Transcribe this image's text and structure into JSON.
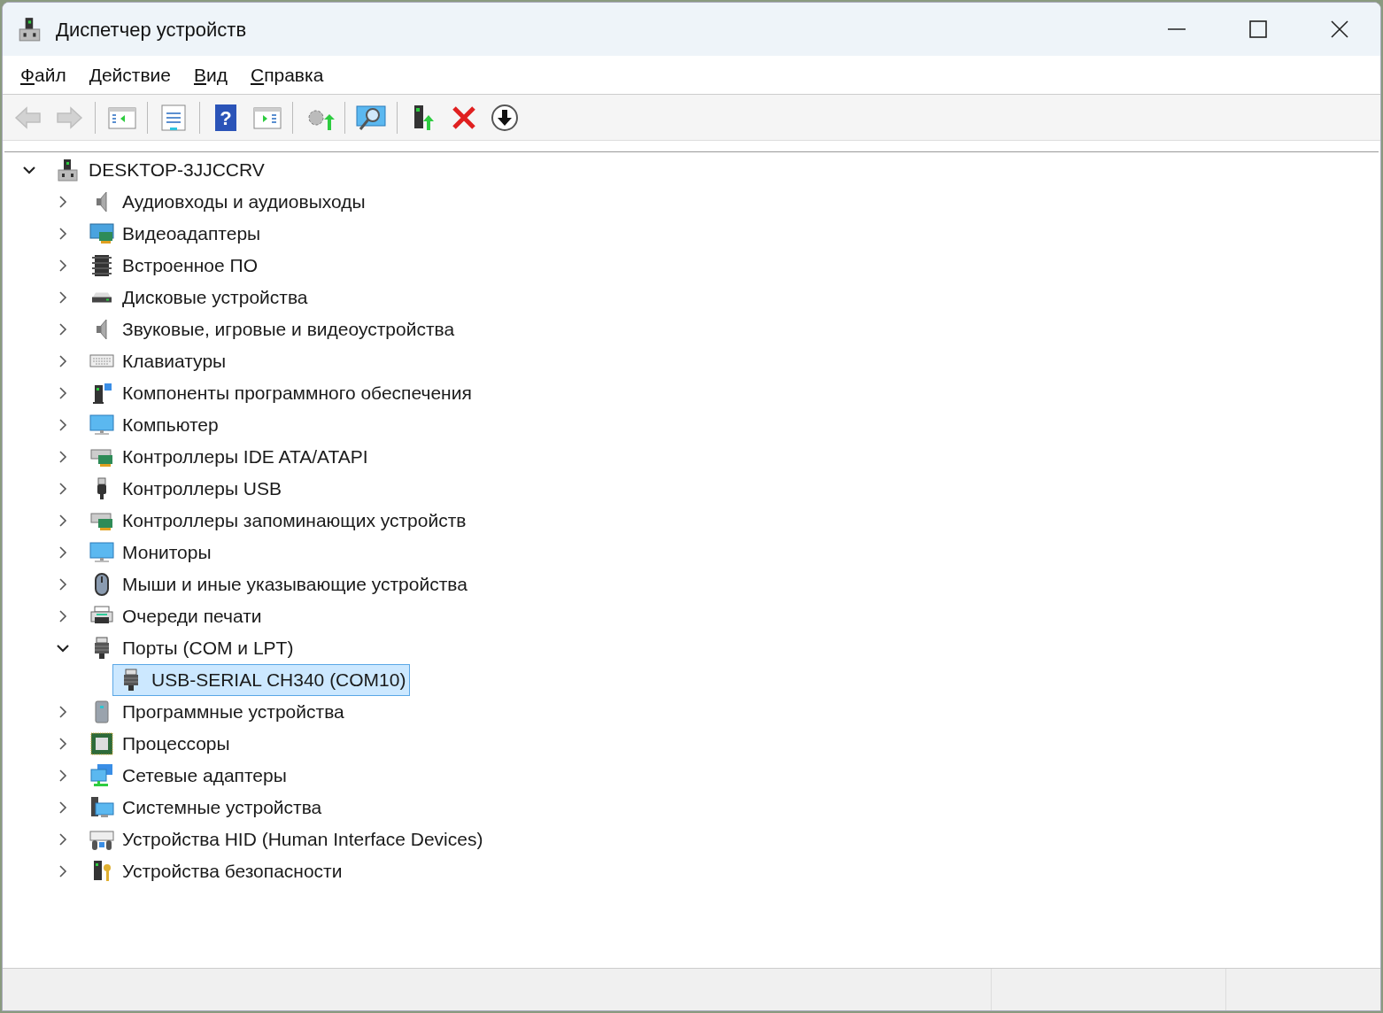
{
  "window": {
    "title": "Диспетчер устройств"
  },
  "menu": [
    {
      "label": "Файл"
    },
    {
      "label": "Действие"
    },
    {
      "label": "Вид"
    },
    {
      "label": "Справка"
    }
  ],
  "toolbar": [
    {
      "kind": "back",
      "disabled": true
    },
    {
      "kind": "forward",
      "disabled": true
    },
    {
      "kind": "separator"
    },
    {
      "kind": "tree-pane",
      "disabled": false
    },
    {
      "kind": "separator"
    },
    {
      "kind": "properties",
      "disabled": false
    },
    {
      "kind": "separator"
    },
    {
      "kind": "help",
      "disabled": false,
      "glyph": "?"
    },
    {
      "kind": "action-pane",
      "disabled": false
    },
    {
      "kind": "separator"
    },
    {
      "kind": "update",
      "disabled": false
    },
    {
      "kind": "separator"
    },
    {
      "kind": "scan",
      "disabled": false
    },
    {
      "kind": "separator"
    },
    {
      "kind": "enable",
      "disabled": false
    },
    {
      "kind": "remove",
      "disabled": false
    },
    {
      "kind": "disable",
      "disabled": false
    }
  ],
  "tree": {
    "label": "DESKTOP-3JJCCRV",
    "kind": "computer-root",
    "expanded": true,
    "selected": false,
    "children": [
      {
        "label": "Аудиовходы и аудиовыходы",
        "kind": "speaker",
        "expanded": false,
        "selected": false
      },
      {
        "label": "Видеоадаптеры",
        "kind": "display-adapter",
        "expanded": false,
        "selected": false
      },
      {
        "label": "Встроенное ПО",
        "kind": "chip",
        "expanded": false,
        "selected": false
      },
      {
        "label": "Дисковые устройства",
        "kind": "disk",
        "expanded": false,
        "selected": false
      },
      {
        "label": "Звуковые, игровые и видеоустройства",
        "kind": "speaker",
        "expanded": false,
        "selected": false
      },
      {
        "label": "Клавиатуры",
        "kind": "keyboard",
        "expanded": false,
        "selected": false
      },
      {
        "label": "Компоненты программного обеспечения",
        "kind": "software-component",
        "expanded": false,
        "selected": false
      },
      {
        "label": "Компьютер",
        "kind": "monitor",
        "expanded": false,
        "selected": false
      },
      {
        "label": "Контроллеры IDE ATA/ATAPI",
        "kind": "controller",
        "expanded": false,
        "selected": false
      },
      {
        "label": "Контроллеры USB",
        "kind": "usb",
        "expanded": false,
        "selected": false
      },
      {
        "label": "Контроллеры запоминающих устройств",
        "kind": "controller",
        "expanded": false,
        "selected": false
      },
      {
        "label": "Мониторы",
        "kind": "monitor",
        "expanded": false,
        "selected": false
      },
      {
        "label": "Мыши и иные указывающие устройства",
        "kind": "mouse",
        "expanded": false,
        "selected": false
      },
      {
        "label": "Очереди печати",
        "kind": "printer",
        "expanded": false,
        "selected": false
      },
      {
        "label": "Порты (COM и LPT)",
        "kind": "port",
        "expanded": true,
        "selected": false,
        "children": [
          {
            "label": "USB-SERIAL CH340 (COM10)",
            "kind": "port",
            "selected": true
          }
        ]
      },
      {
        "label": "Программные устройства",
        "kind": "software-device",
        "expanded": false,
        "selected": false
      },
      {
        "label": "Процессоры",
        "kind": "processor",
        "expanded": false,
        "selected": false
      },
      {
        "label": "Сетевые адаптеры",
        "kind": "network",
        "expanded": false,
        "selected": false
      },
      {
        "label": "Системные устройства",
        "kind": "system",
        "expanded": false,
        "selected": false
      },
      {
        "label": "Устройства HID (Human Interface Devices)",
        "kind": "hid",
        "expanded": false,
        "selected": false
      },
      {
        "label": "Устройства безопасности",
        "kind": "security",
        "expanded": false,
        "selected": false
      }
    ]
  }
}
